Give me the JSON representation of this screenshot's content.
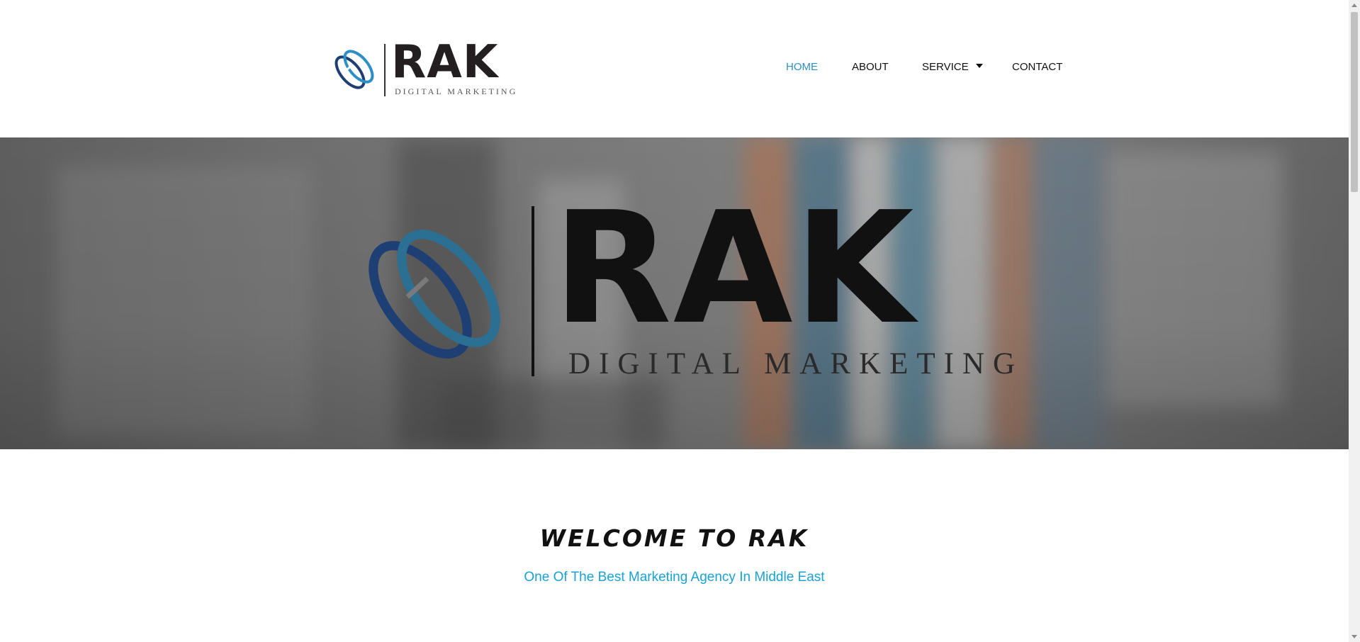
{
  "header": {
    "logo": {
      "word": "RAK",
      "subtitle": "DIGITAL MARKETING"
    },
    "nav": [
      {
        "label": "HOME",
        "active": true
      },
      {
        "label": "ABOUT",
        "active": false
      },
      {
        "label": "SERVICE",
        "has_dropdown": true,
        "active": false
      },
      {
        "label": "CONTACT",
        "active": false
      }
    ]
  },
  "hero": {
    "logo_word": "RAK",
    "logo_subtitle": "DIGITAL MARKETING"
  },
  "welcome": {
    "title": "WELCOME TO RAK",
    "subtitle": "One Of The Best Marketing Agency In Middle East"
  },
  "colors": {
    "accent": "#2c8fc9",
    "subtitle_accent": "#1aa1d6",
    "logo_dark_blue": "#1d3f73",
    "logo_light_blue": "#2d8fc7",
    "text_dark": "#111111"
  },
  "icons": {
    "logo_mark": "interlocked-rings-icon",
    "dropdown": "caret-down-icon",
    "scroll_up": "arrow-up-icon",
    "scroll_down": "arrow-down-icon"
  }
}
